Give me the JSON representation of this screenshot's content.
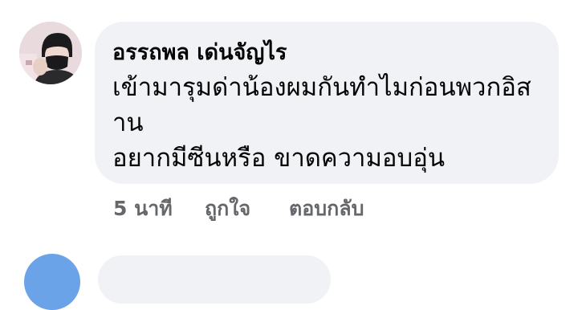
{
  "comment": {
    "author": "อรรถพล เด่นจัญไร",
    "lines": [
      "เข้ามารุมด่าน้องผมกันทำไมก่อนพวกอิส",
      "าน",
      "อยากมีซีนหรือ ขาดความอบอุ่น"
    ],
    "time": "5 นาที",
    "like_label": "ถูกใจ",
    "reply_label": "ตอบกลับ"
  },
  "colors": {
    "bubble": "#f0f2f5",
    "meta_text": "#65676b",
    "text": "#050505",
    "next_avatar": "#6aa3e8"
  }
}
